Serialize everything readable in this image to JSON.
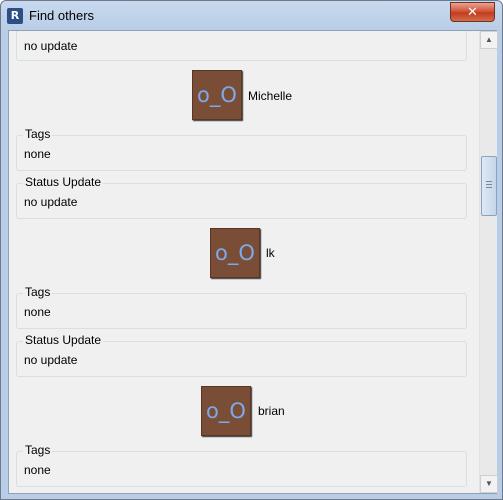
{
  "window": {
    "title": "Find others",
    "logo_text": "R",
    "close_symbol": "✕",
    "icons": {
      "logo": "app-logo",
      "close": "close-icon"
    }
  },
  "first_section": {
    "title": "",
    "value": "no update"
  },
  "people": [
    {
      "name": "Michelle",
      "avatar_text": "o_O",
      "tags": {
        "title": "Tags",
        "value": "none"
      },
      "status": {
        "title": "Status Update",
        "value": "no update"
      }
    },
    {
      "name": "lk",
      "avatar_text": "o_O",
      "tags": {
        "title": "Tags",
        "value": "none"
      },
      "status": {
        "title": "Status Update",
        "value": "no update"
      }
    },
    {
      "name": "brian",
      "avatar_text": "o_O",
      "tags": {
        "title": "Tags",
        "value": "none"
      }
    }
  ],
  "scrollbar": {
    "up_arrow": "▲",
    "down_arrow": "▼",
    "position_fraction": 0.28
  },
  "colors": {
    "avatar_bg": "#7a4d36",
    "avatar_text": "#7ea9e8",
    "close_button": "#c13d20"
  }
}
